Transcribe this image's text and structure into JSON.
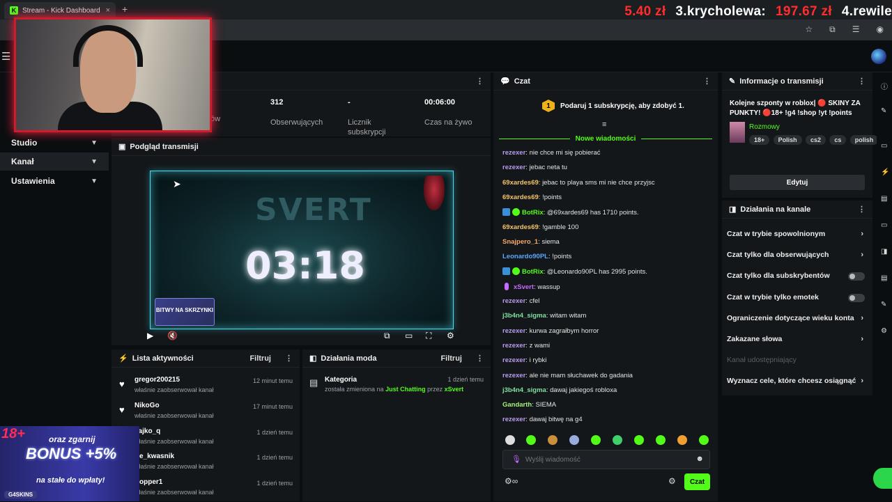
{
  "browser": {
    "tab_title": "Stream - Kick Dashboard",
    "tab_close": "×",
    "new_tab": "+"
  },
  "ticker": {
    "amount_1": "5.40 zł",
    "entry_2": "3.krycholewa:",
    "amount_2": "197.67 zł",
    "entry_3": "4.rewile"
  },
  "stats": [
    {
      "value": "312",
      "label": "Obserwujących"
    },
    {
      "value": "-",
      "label": "Licznik subskrypcji"
    },
    {
      "value": "00:06:00",
      "label": "Czas na żywo"
    }
  ],
  "stats_partial": "ów",
  "sidebar": {
    "items": [
      {
        "label": "Studio"
      },
      {
        "label": "Kanał"
      },
      {
        "label": "Ustawienia"
      }
    ]
  },
  "preview": {
    "title": "Podgląd transmisji",
    "svert": "SVERT",
    "timer": "03:18",
    "promo": "BITWY NA SKRZYNKI"
  },
  "activity": {
    "title": "Lista aktywności",
    "filter": "Filtruj",
    "items": [
      {
        "name": "gregor200215",
        "desc": "właśnie zaobserwował kanał",
        "time": "12 minut temu"
      },
      {
        "name": "NikoGo",
        "desc": "właśnie zaobserwował kanał",
        "time": "17 minut temu"
      },
      {
        "name": "Jajko_q",
        "desc": "właśnie zaobserwował kanał",
        "time": "1 dzień temu"
      },
      {
        "name": "e_kwasnik",
        "desc": "właśnie zaobserwował kanał",
        "time": "1 dzień temu"
      },
      {
        "name": "opper1",
        "desc": "właśnie zaobserwował kanał",
        "time": "1 dzień temu"
      }
    ]
  },
  "mod": {
    "title": "Działania moda",
    "filter": "Filtruj",
    "item_title": "Kategoria",
    "item_time": "1 dzień temu",
    "item_text": "została zmieniona na",
    "item_category": "Just Chatting",
    "item_by": "przez",
    "item_user": "xSvert"
  },
  "ad": {
    "badge": "18+",
    "line1": "oraz zgarnij",
    "line2": "BONUS +5%",
    "line3": "na stałe do wpłaty!",
    "brand": "G4SKINS"
  },
  "chat": {
    "title": "Czat",
    "sub_promo": "Podaruj 1 subskrypcję, aby zdobyć 1.",
    "new_messages": "Nowe wiadomości",
    "messages": [
      {
        "user": "rezexer",
        "color": "#b99cf0",
        "text": "nie chce mi się pobierać"
      },
      {
        "user": "rezexer",
        "color": "#b99cf0",
        "text": "jebac neta tu"
      },
      {
        "user": "69xardes69",
        "color": "#f4c36a",
        "text": "jebac to playa sms mi nie chce przyjsc"
      },
      {
        "user": "69xardes69",
        "color": "#f4c36a",
        "text": "!points"
      },
      {
        "user": "BotRix",
        "color": "#53fc18",
        "text": "@69xardes69 has 1710 points.",
        "badges": true
      },
      {
        "user": "69xardes69",
        "color": "#f4c36a",
        "text": "!gamble 100"
      },
      {
        "user": "Snajpero_1",
        "color": "#f7a96b",
        "text": "siema"
      },
      {
        "user": "Leonardo90PL",
        "color": "#5aa8ff",
        "text": "!points"
      },
      {
        "user": "BotRix",
        "color": "#53fc18",
        "text": "@Leonardo90PL has 2995 points.",
        "badges": true
      },
      {
        "user": "xSvert",
        "color": "#c66bff",
        "text": "wassup",
        "mic": true
      },
      {
        "user": "rezexer",
        "color": "#b99cf0",
        "text": "cfel"
      },
      {
        "user": "j3b4n4_sigma",
        "color": "#7fe0a0",
        "text": "witam witam"
      },
      {
        "user": "rezexer",
        "color": "#b99cf0",
        "text": "kurwa zagrałbym horror"
      },
      {
        "user": "rezexer",
        "color": "#b99cf0",
        "text": "z wami"
      },
      {
        "user": "rezexer",
        "color": "#b99cf0",
        "text": "i rybki"
      },
      {
        "user": "rezexer",
        "color": "#b99cf0",
        "text": "ale nie mam słuchawek do gadania"
      },
      {
        "user": "j3b4n4_sigma",
        "color": "#7fe0a0",
        "text": "dawaj jakiegoś robloxa"
      },
      {
        "user": "Gandarth",
        "color": "#a6f07a",
        "text": "SIEMA"
      },
      {
        "user": "rezexer",
        "color": "#b99cf0",
        "text": "dawaj bitwę na g4"
      }
    ],
    "input_placeholder": "Wyślij wiadomość",
    "send_label": "Czat"
  },
  "info": {
    "title": "Informacje o transmisji",
    "stream_title": "Kolejne szponty w roblox| 🔴 SKINY ZA PUNKTY! 🔴18+ !g4 !shop !yt !points",
    "category": "Rozmowy",
    "tags": [
      "18+",
      "Polish",
      "cs2",
      "cs",
      "polish"
    ],
    "edit_label": "Edytuj"
  },
  "actions": {
    "title": "Działania na kanale",
    "items": [
      {
        "label": "Czat w trybie spowolnionym",
        "kind": "arrow"
      },
      {
        "label": "Czat tylko dla obserwujących",
        "kind": "arrow"
      },
      {
        "label": "Czat tylko dla subskrybentów",
        "kind": "toggle"
      },
      {
        "label": "Czat w trybie tylko emotek",
        "kind": "toggle"
      },
      {
        "label": "Ograniczenie dotyczące wieku konta",
        "kind": "arrow"
      },
      {
        "label": "Zakazane słowa",
        "kind": "arrow"
      },
      {
        "label": "Kanał udostępniający",
        "kind": "disabled"
      },
      {
        "label": "Wyznacz cele, które chcesz osiągnąć",
        "kind": "arrow"
      }
    ]
  },
  "colors": {
    "accent": "#53fc18",
    "panel": "#14171a",
    "background": "#0b0e10"
  }
}
